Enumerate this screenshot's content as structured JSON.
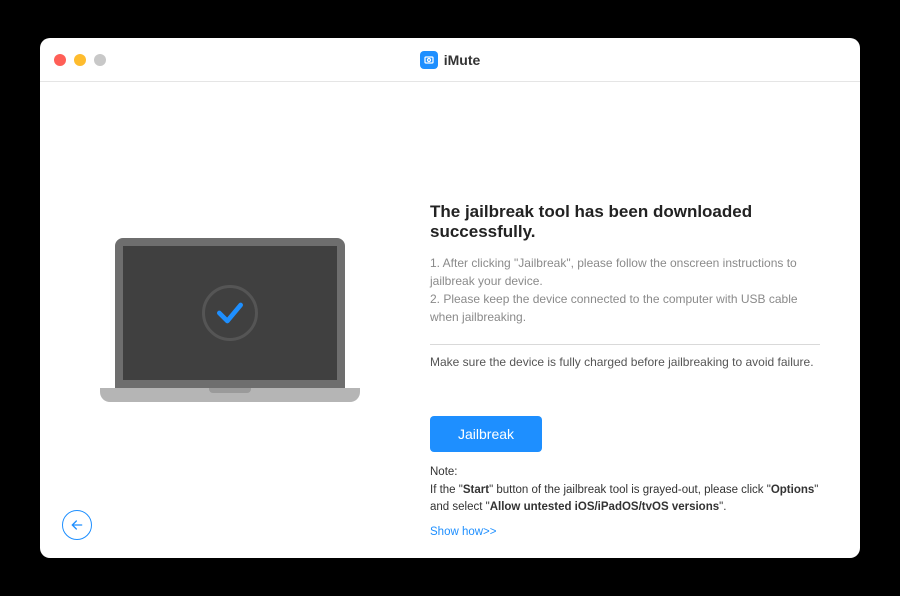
{
  "app": {
    "title": "iMute"
  },
  "main": {
    "heading": "The jailbreak tool has been downloaded successfully.",
    "instruction1": "1. After clicking \"Jailbreak\", please follow the onscreen instructions to jailbreak your device.",
    "instruction2": "2. Please keep the device connected to the computer with USB cable when jailbreaking.",
    "warning": "Make sure the device is fully charged before jailbreaking to avoid failure.",
    "button_label": "Jailbreak",
    "note_label": "Note:",
    "note_text_1": "If the \"",
    "note_bold_1": "Start",
    "note_text_2": "\" button of the jailbreak tool is grayed-out, please click \"",
    "note_bold_2": "Options",
    "note_text_3": "\" and select \"",
    "note_bold_3": "Allow untested iOS/iPadOS/tvOS versions",
    "note_text_4": "\".",
    "show_link": "Show how>>"
  },
  "colors": {
    "accent": "#1e8fff"
  }
}
